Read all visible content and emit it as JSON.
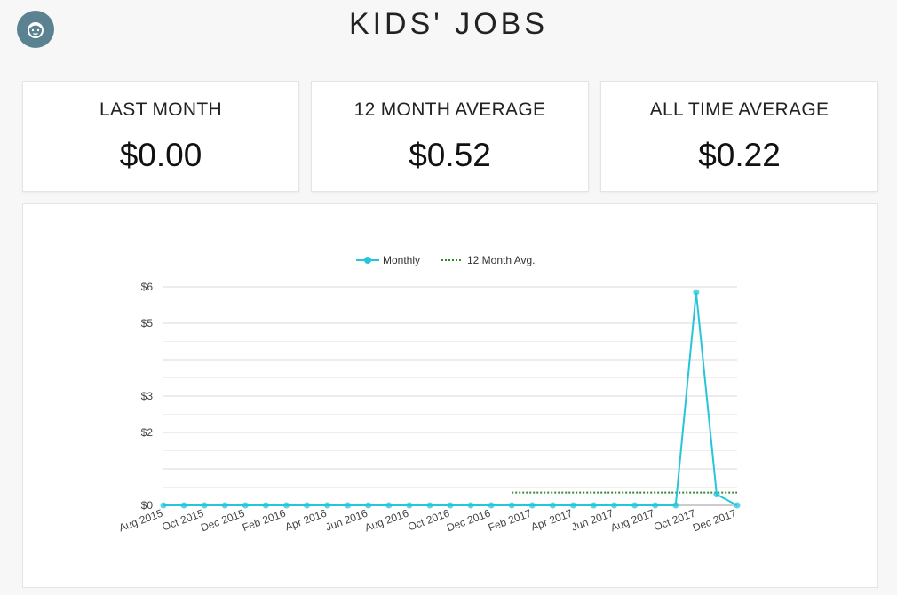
{
  "header": {
    "title": "KIDS' JOBS",
    "avatar_icon": "child-face-icon"
  },
  "stats": [
    {
      "label": "LAST MONTH",
      "value": "$0.00"
    },
    {
      "label": "12 MONTH AVERAGE",
      "value": "$0.52"
    },
    {
      "label": "ALL TIME AVERAGE",
      "value": "$0.22"
    }
  ],
  "colors": {
    "monthly": "#26c6da",
    "avg": "#2e8b2e",
    "avatar_bg": "#5b8291",
    "grid": "#d9d9d9"
  },
  "chart_data": {
    "type": "line",
    "x": [
      "Aug 2015",
      "Sep 2015",
      "Oct 2015",
      "Nov 2015",
      "Dec 2015",
      "Jan 2016",
      "Feb 2016",
      "Mar 2016",
      "Apr 2016",
      "May 2016",
      "Jun 2016",
      "Jul 2016",
      "Aug 2016",
      "Sep 2016",
      "Oct 2016",
      "Nov 2016",
      "Dec 2016",
      "Jan 2017",
      "Feb 2017",
      "Mar 2017",
      "Apr 2017",
      "May 2017",
      "Jun 2017",
      "Jul 2017",
      "Aug 2017",
      "Sep 2017",
      "Oct 2017",
      "Nov 2017",
      "Dec 2017"
    ],
    "x_tick_labels": [
      "Aug 2015",
      "Oct 2015",
      "Dec 2015",
      "Feb 2016",
      "Apr 2016",
      "Jun 2016",
      "Aug 2016",
      "Oct 2016",
      "Dec 2016",
      "Feb 2017",
      "Apr 2017",
      "Jun 2017",
      "Aug 2017",
      "Oct 2017",
      "Dec 2017"
    ],
    "series": [
      {
        "name": "Monthly",
        "style": "solid-with-markers",
        "values": [
          0,
          0,
          0,
          0,
          0,
          0,
          0,
          0,
          0,
          0,
          0,
          0,
          0,
          0,
          0,
          0,
          0,
          0,
          0,
          0,
          0,
          0,
          0,
          0,
          0,
          0,
          5.85,
          0.3,
          0
        ]
      },
      {
        "name": "12 Month Avg.",
        "style": "dotted",
        "values": [
          null,
          null,
          null,
          null,
          null,
          null,
          null,
          null,
          null,
          null,
          null,
          null,
          null,
          null,
          null,
          null,
          null,
          0.35,
          0.35,
          0.35,
          0.35,
          0.35,
          0.35,
          0.35,
          0.35,
          0.35,
          0.35,
          0.35,
          0.35
        ]
      }
    ],
    "ylim": [
      0,
      6
    ],
    "y_ticks": [
      0,
      1,
      2,
      3,
      4,
      5,
      6
    ],
    "y_tick_labels": [
      "$0",
      "",
      "$2",
      "$3",
      "",
      "$5",
      "$6"
    ],
    "legend_position": "top-center",
    "grid": true
  }
}
